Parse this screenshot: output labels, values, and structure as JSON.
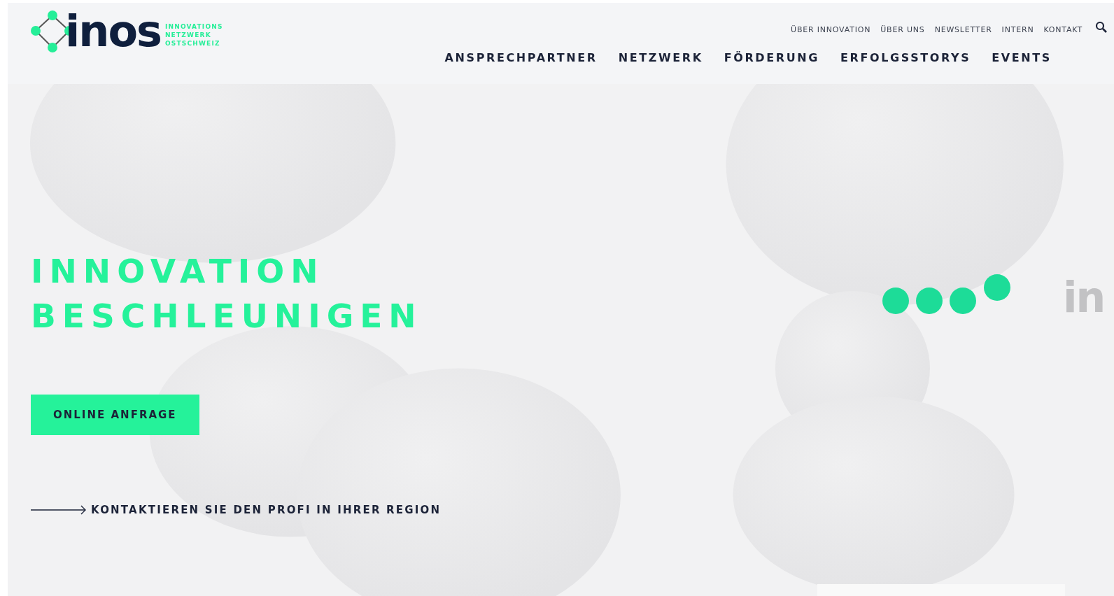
{
  "logo": {
    "wordmark": "inos",
    "tagline": [
      "INNOVATIONS",
      "NETZWERK",
      "OSTSCHWEIZ"
    ]
  },
  "top_nav": [
    "ÜBER INNOVATION",
    "ÜBER UNS",
    "NEWSLETTER",
    "INTERN",
    "KONTAKT"
  ],
  "main_nav": [
    "ANSPRECHPARTNER",
    "NETZWERK",
    "FÖRDERUNG",
    "ERFOLGSSTORYS",
    "EVENTS"
  ],
  "hero": {
    "title": [
      "INNOVATION",
      "BESCHLEUNIGEN"
    ],
    "button": "ONLINE ANFRAGE",
    "link": "KONTAKTIEREN SIE DEN PROFI IN IHRER REGION",
    "animation_text": "in"
  }
}
